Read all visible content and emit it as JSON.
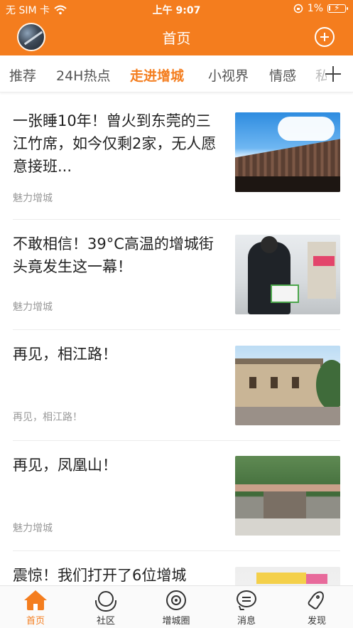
{
  "status_bar": {
    "carrier": "无 SIM 卡",
    "time": "上午 9:07",
    "battery": "1%"
  },
  "nav": {
    "title": "首页"
  },
  "tabs": [
    "推荐",
    "24H热点",
    "走进增城",
    "小视界",
    "情感",
    "私"
  ],
  "active_tab": "走进增城",
  "articles": [
    {
      "title": "一张睡10年！曾火到东莞的三江竹席，如今仅剩2家，无人愿意接班...",
      "source": "魅力增城"
    },
    {
      "title": "不敢相信！39°C高温的增城街头竟发生这一幕！",
      "source": "魅力增城"
    },
    {
      "title": "再见，相江路！",
      "source": "再见，相江路！"
    },
    {
      "title": "再见，凤凰山！",
      "source": "魅力增城"
    },
    {
      "title": "震惊！我们打开了6位增城",
      "source": ""
    }
  ],
  "bottom_nav": {
    "home": "首页",
    "community": "社区",
    "circle": "增城圈",
    "messages": "消息",
    "discover": "发现"
  },
  "colors": {
    "accent": "#f47d1e"
  }
}
